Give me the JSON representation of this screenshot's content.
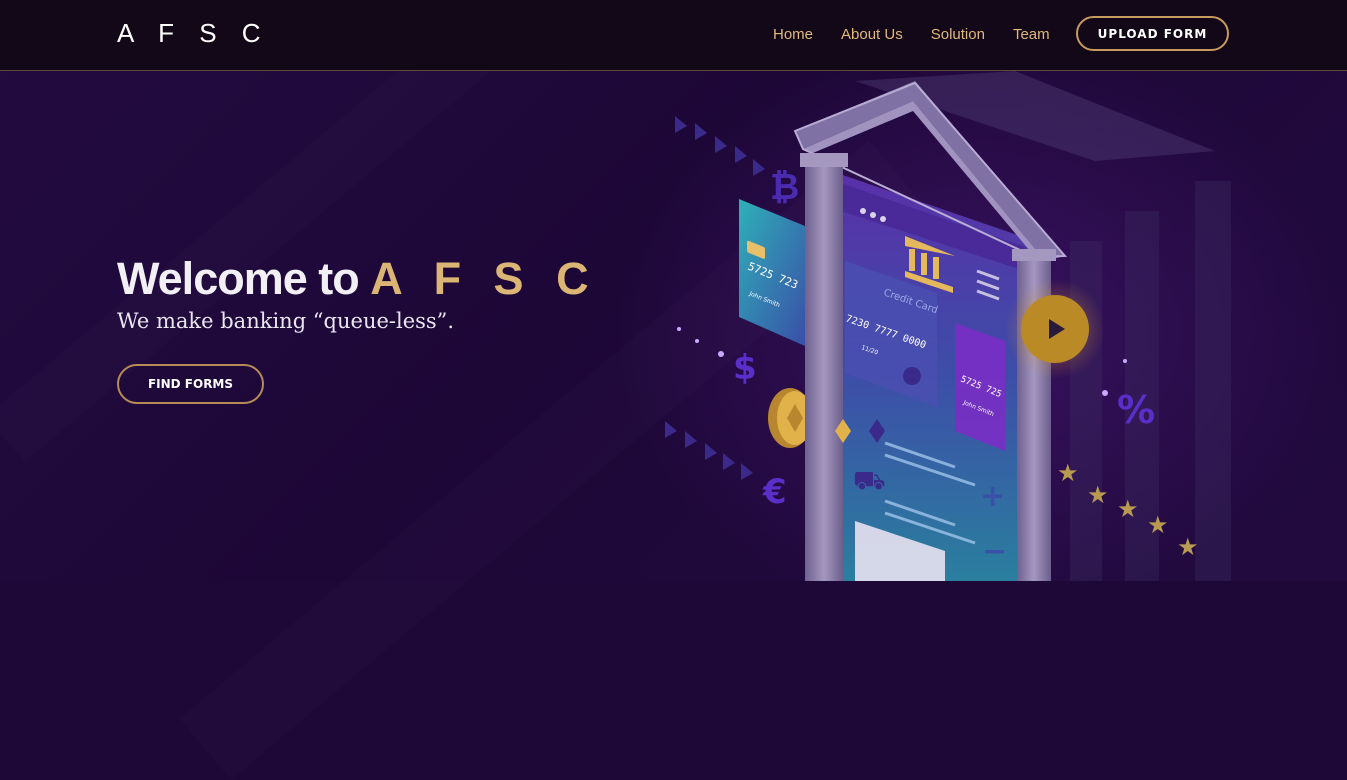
{
  "navbar": {
    "logo": "A F S C",
    "links": [
      "Home",
      "About Us",
      "Solution",
      "Team"
    ],
    "upload_label": "UPLOAD FORM"
  },
  "hero": {
    "title_prefix": "Welcome to ",
    "title_brand": "A F S C",
    "subtitle": "We make banking “queue-less”.",
    "cta_label": "FIND FORMS"
  },
  "illustration": {
    "card_left_number": "5725 723",
    "card_left_name": "John Smith",
    "credit_card_label": "Credit Card",
    "credit_card_number": "7230 7777 0000",
    "credit_card_expiry": "11/20",
    "card_right_number": "5725 725",
    "card_right_name": "John Smith"
  },
  "colors": {
    "background": "#1e0838",
    "navbar": "#130817",
    "accent_gold": "#dab573",
    "nav_link": "#e2b77a",
    "pillar": "#8e7fad"
  },
  "icons": [
    "bitcoin-icon",
    "dollar-icon",
    "euro-icon",
    "percent-icon",
    "bank-icon",
    "menu-icon",
    "play-icon",
    "star-icon",
    "coin-icon",
    "cart-icon",
    "plus-icon",
    "minus-icon"
  ]
}
